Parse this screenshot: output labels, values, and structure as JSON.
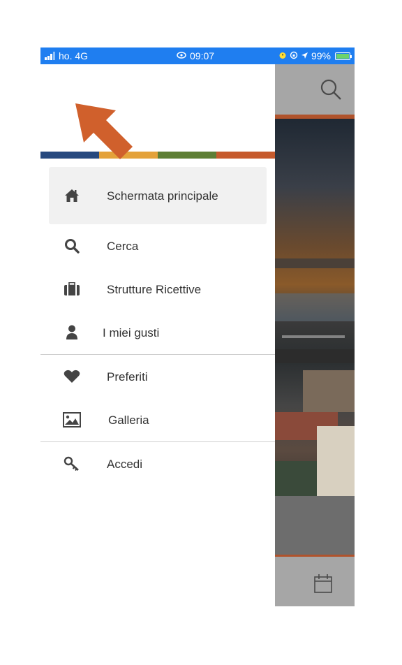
{
  "status_bar": {
    "carrier": "ho. 4G",
    "time": "09:07",
    "battery": "99%",
    "background_color": "#1f7ef0"
  },
  "drawer": {
    "color_bar": [
      "#27497e",
      "#e4a23a",
      "#5e7e35",
      "#c65a2c"
    ],
    "menu_items": [
      {
        "label": "Schermata principale",
        "icon": "home-icon"
      },
      {
        "label": "Cerca",
        "icon": "search-icon"
      },
      {
        "label": "Strutture Ricettive",
        "icon": "suitcase-icon"
      },
      {
        "label": "I miei gusti",
        "icon": "user-icon"
      },
      {
        "label": "Preferiti",
        "icon": "heart-icon"
      },
      {
        "label": "Galleria",
        "icon": "image-icon"
      },
      {
        "label": "Accedi",
        "icon": "key-icon"
      }
    ]
  },
  "background_app": {
    "header_icon": "search-icon",
    "footer_icon": "calendar-icon",
    "accent_color": "#b0532c"
  },
  "annotation": {
    "arrow_color": "#d0602c"
  }
}
